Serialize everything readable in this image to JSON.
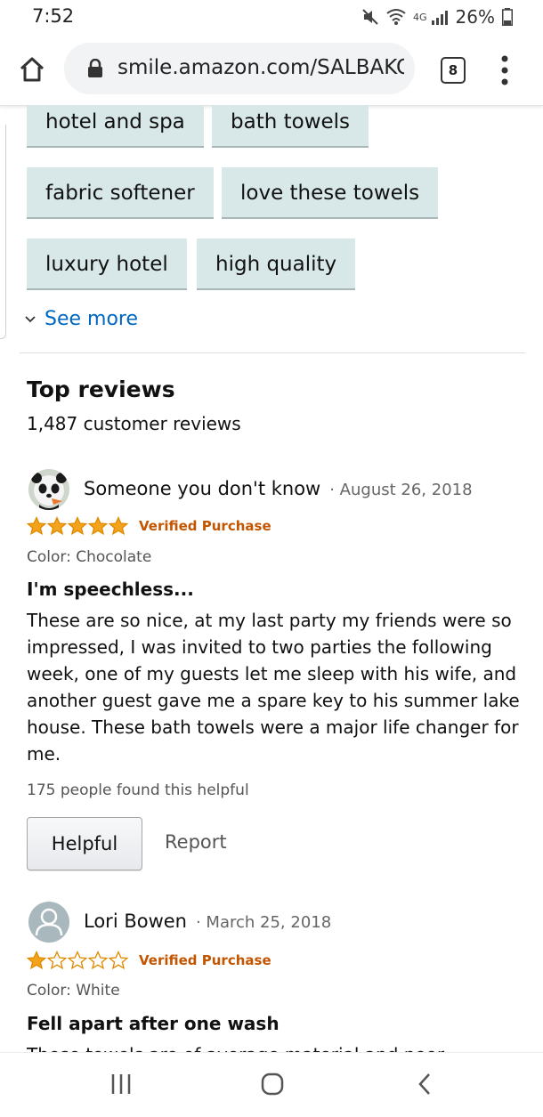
{
  "status_bar": {
    "time": "7:52",
    "battery": "26%",
    "network": "4G"
  },
  "browser": {
    "url": "smile.amazon.com/SALBAKOS",
    "tab_count": "8"
  },
  "tags": {
    "items": [
      "hotel and spa",
      "bath towels",
      "fabric softener",
      "love these towels",
      "luxury hotel",
      "high quality"
    ],
    "see_more": "See more"
  },
  "reviews_section": {
    "title": "Top reviews",
    "count_label": "1,487 customer reviews"
  },
  "reviews": [
    {
      "name": "Someone you don't know",
      "date": "· August 26, 2018",
      "rating": 5,
      "verified": "Verified Purchase",
      "color": "Color: Chocolate",
      "title": "I'm speechless...",
      "body": "These are so nice, at my last party my friends were so impressed, I was invited to two parties the following week, one of my guests let me sleep with his wife, and another guest gave me a spare key to his summer lake house. These bath towels were a major life changer for me.",
      "helpful_count": "175 people found this helpful",
      "helpful_label": "Helpful",
      "report_label": "Report"
    },
    {
      "name": "Lori Bowen",
      "date": "· March 25, 2018",
      "rating": 1,
      "verified": "Verified Purchase",
      "color": "Color: White",
      "title": "Fell apart after one wash",
      "body": "These towels are of average material and poor"
    }
  ],
  "colors": {
    "chip_bg": "#d8e8e9",
    "link": "#0066c0",
    "star": "#f4a41c",
    "verified": "#c45500"
  },
  "icons": [
    "home-icon",
    "lock-icon",
    "tab-switcher-icon",
    "overflow-menu-icon",
    "chevron-down-icon",
    "star-icon",
    "default-avatar-icon",
    "recents-icon",
    "home-circle-icon",
    "back-icon"
  ]
}
